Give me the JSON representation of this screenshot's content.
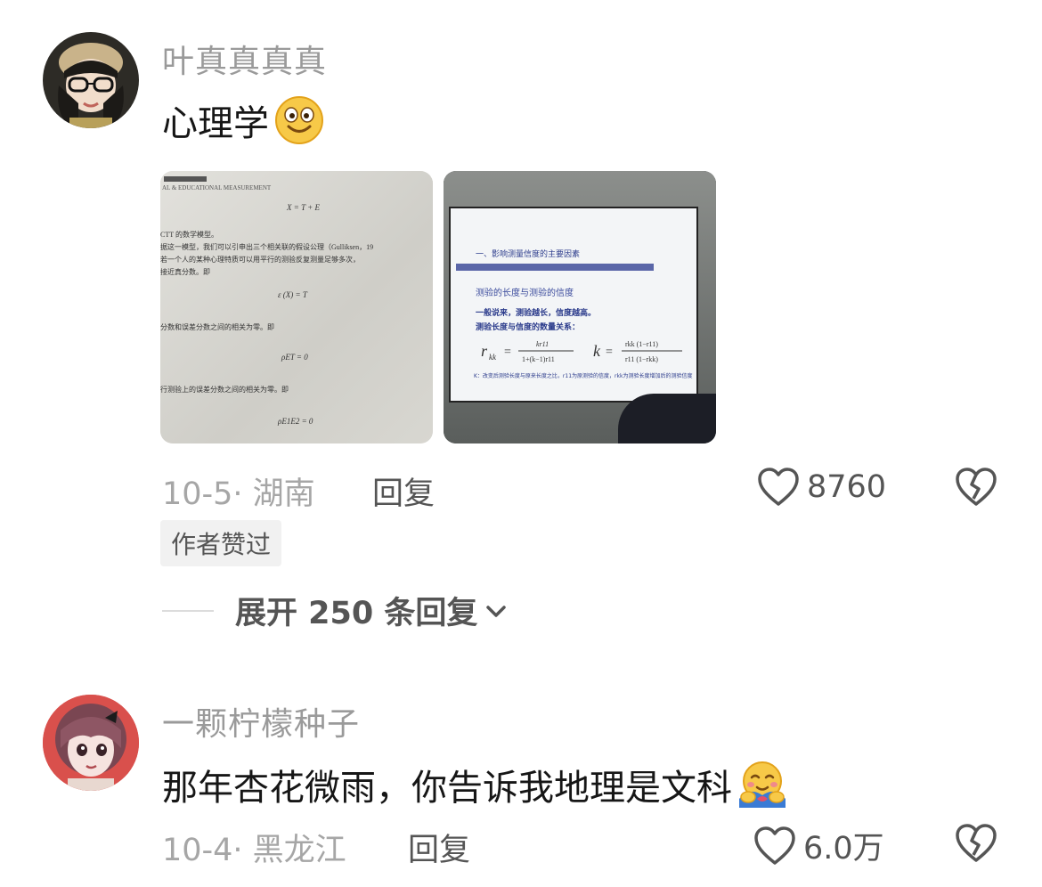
{
  "comments": [
    {
      "username": "叶真真真真",
      "text": "心理学",
      "emoji": "grinning-face-emoji",
      "date_location": "10-5· 湖南",
      "reply_label": "回复",
      "like_count": "8760",
      "badge": "作者赞过",
      "images": [
        {
          "kind": "textbook-page-photo",
          "lines": [
            "AL & EDUCATIONAL MEASUREMENT",
            "X = T + E",
            "CTT 的数学模型。",
            "据这一模型，我们可以引申出三个相关联的假设公理（Gulliksen，19",
            "若一个人的某种心理特质可以用平行的测验反复测量足够多次，",
            "接近真分数。即",
            "ε (X)  = T",
            "分数和误差分数之间的相关为零。即",
            "ρET = 0",
            "行测验上的误差分数之间的相关为零。即",
            "ρE1E2 = 0"
          ]
        },
        {
          "kind": "lecture-slide-photo",
          "lines": [
            "一、影响测量信度的主要因素",
            "测验的长度与测验的信度",
            "一般说来，测验越长，信度越高。",
            "测验长度与信度的数量关系：",
            "K：改变后测验长度与原来长度之比，r11为原测验的信度，rkk为测验长度增加后的测验信度"
          ]
        }
      ]
    },
    {
      "username": "一颗柠檬种子",
      "text": "那年杏花微雨，你告诉我地理是文科",
      "emoji": "hugging-face-emoji",
      "date_location": "10-4· 黑龙江",
      "reply_label": "回复",
      "like_count": "6.0万"
    }
  ],
  "expand_replies": "展开 250 条回复"
}
